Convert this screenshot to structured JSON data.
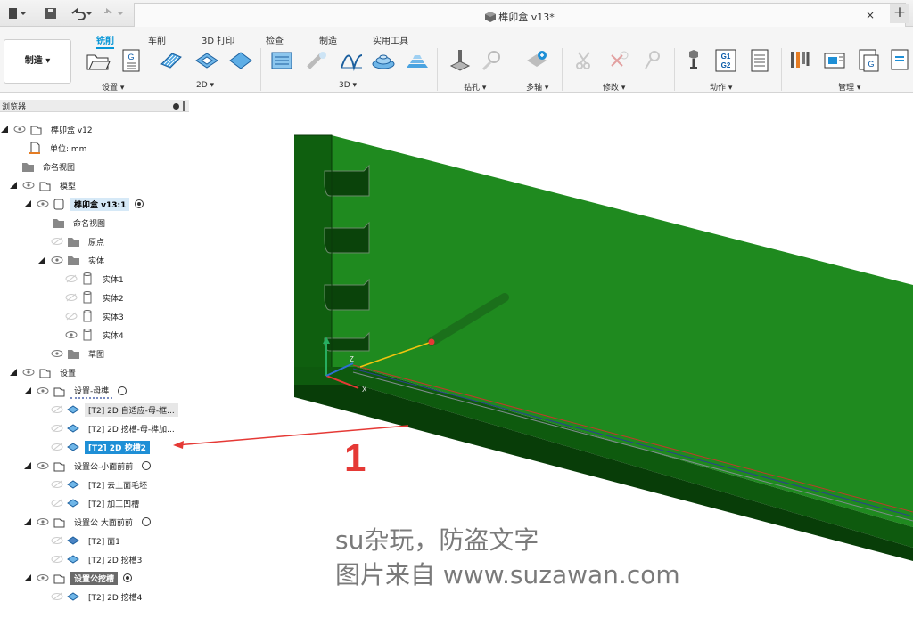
{
  "window": {
    "doc_title": "榫卯盒 v13*",
    "close_tab": "×",
    "new_tab": "+"
  },
  "ribbon": {
    "workspace": "制造 ▾",
    "tabs": [
      "铣削",
      "车削",
      "3D 打印",
      "检查",
      "制造",
      "实用工具"
    ],
    "active_tab": "铣削",
    "groups": [
      "设置 ▾",
      "2D ▾",
      "3D ▾",
      "钻孔 ▾",
      "多轴 ▾",
      "修改 ▾",
      "动作 ▾",
      "管理 ▾"
    ]
  },
  "browser": {
    "title": "浏览器",
    "items": [
      {
        "label": "榫卯盒 v12"
      },
      {
        "label": "单位: mm"
      },
      {
        "label": "命名视图"
      },
      {
        "label": "模型"
      },
      {
        "label": "榫卯盒 v13:1"
      },
      {
        "label": "命名视图"
      },
      {
        "label": "原点"
      },
      {
        "label": "实体"
      },
      {
        "label": "实体1"
      },
      {
        "label": "实体2"
      },
      {
        "label": "实体3"
      },
      {
        "label": "实体4"
      },
      {
        "label": "草图"
      },
      {
        "label": "设置"
      },
      {
        "label": "设置-母榫"
      },
      {
        "label": "[T2] 2D 自适应-母-框..."
      },
      {
        "label": "[T2] 2D 挖槽-母-榫加..."
      },
      {
        "label": "[T2] 2D 挖槽2"
      },
      {
        "label": "设置公-小面前前"
      },
      {
        "label": "[T2] 去上面毛坯"
      },
      {
        "label": "[T2] 加工凹槽"
      },
      {
        "label": "设置公 大面前前"
      },
      {
        "label": "[T2] 面1"
      },
      {
        "label": "[T2] 2D 挖槽3"
      },
      {
        "label": "设置公挖槽"
      },
      {
        "label": "[T2] 2D 挖槽4"
      }
    ]
  },
  "annotation": {
    "number": "1",
    "color": "#e53935"
  },
  "watermark": {
    "line1": "su杂玩，防盗文字",
    "line2": "图片来自 www.suzawan.com"
  },
  "colors": {
    "accent": "#0696d7",
    "selection": "#1e8fd6",
    "model_green": "#1f8a1f"
  }
}
